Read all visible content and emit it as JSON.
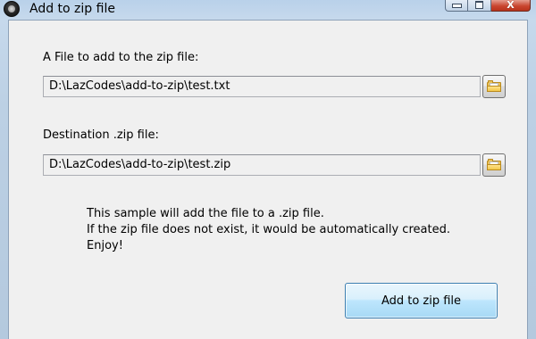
{
  "window": {
    "title": "Add to zip file"
  },
  "form": {
    "source_label": "A File to add to the zip file:",
    "source_value": "D:\\LazCodes\\add-to-zip\\test.txt",
    "destination_label": "Destination .zip file:",
    "destination_value": "D:\\LazCodes\\add-to-zip\\test.zip"
  },
  "info": {
    "lines": [
      "This sample will add the file to a .zip file.",
      "If the zip file does not exist, it would be automatically created.",
      "Enjoy!"
    ]
  },
  "actions": {
    "add_button_label": "Add to zip file"
  },
  "caption": {
    "close_glyph": "X"
  },
  "icons": {
    "app": "app-icon",
    "browse": "folder-icon",
    "minimize": "minimize-icon",
    "maximize": "maximize-icon",
    "close": "close-icon"
  }
}
